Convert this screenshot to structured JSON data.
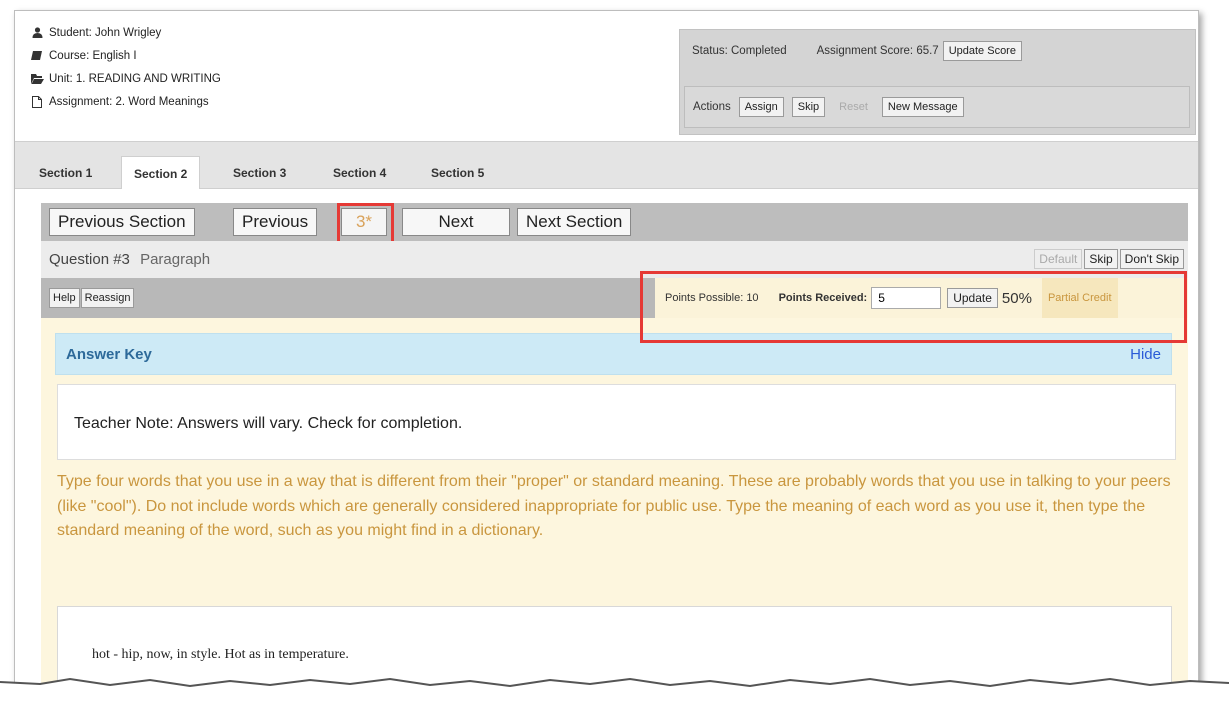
{
  "header": {
    "student": "Student: John Wrigley",
    "course": "Course: English I",
    "unit": "Unit: 1. READING AND WRITING",
    "assignment": "Assignment: 2. Word Meanings"
  },
  "status": {
    "status_text": "Status: Completed",
    "score_text": "Assignment Score: 65.7",
    "update_score_label": "Update Score",
    "actions_label": "Actions",
    "assign_label": "Assign",
    "skip_label": "Skip",
    "reset_label": "Reset",
    "new_message_label": "New Message"
  },
  "tabs": [
    {
      "label": "Section 1",
      "active": false
    },
    {
      "label": "Section 2",
      "active": true
    },
    {
      "label": "Section 3",
      "active": false
    },
    {
      "label": "Section 4",
      "active": false
    },
    {
      "label": "Section 5",
      "active": false
    }
  ],
  "nav": {
    "previous_section": "Previous Section",
    "previous": "Previous",
    "current": "3*",
    "next": "Next",
    "next_section": "Next Section"
  },
  "question": {
    "number": "Question #3",
    "type": "Paragraph",
    "default_label": "Default",
    "skip_label": "Skip",
    "dont_skip_label": "Don't Skip"
  },
  "grading": {
    "help_label": "Help",
    "reassign_label": "Reassign",
    "points_possible": "Points Possible: 10",
    "points_received_label": "Points Received:",
    "points_received_value": "5",
    "update_label": "Update",
    "percent": "50%",
    "credit_status": "Partial Credit"
  },
  "answer_key": {
    "title": "Answer Key",
    "hide_label": "Hide",
    "teacher_note": "Teacher Note: Answers will vary. Check for completion."
  },
  "prompt": "Type four words that you use in a way that is different from their \"proper\" or standard meaning. These are probably words that you use in talking to your peers (like \"cool\"). Do not include words which are generally considered inappropriate for public use. Type the meaning of each word as you use it, then type the standard meaning of the word, such as you might find in a dictionary.",
  "student_answer": "hot - hip, now, in style. Hot as in temperature.",
  "colors": {
    "highlight": "#e53935",
    "prompt_text": "#c9963e",
    "answer_key_bg": "#cdeaf6",
    "link": "#2a5bd7"
  }
}
